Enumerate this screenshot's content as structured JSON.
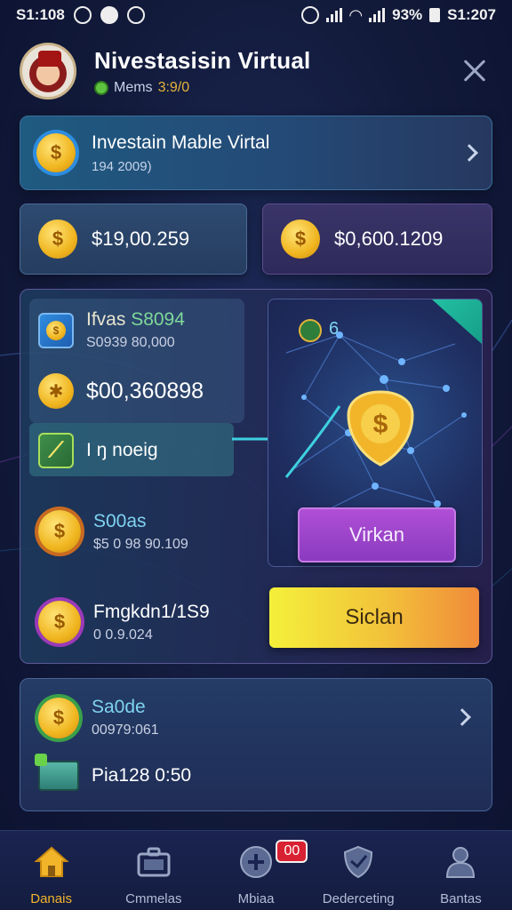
{
  "status_bar": {
    "time": "S1:108",
    "battery": "93%",
    "right_time": "S1:207"
  },
  "header": {
    "title": "Nivestasisin Virtual",
    "status_label": "Mems",
    "status_value": "3:9/0"
  },
  "banner": {
    "title": "Investain Mable Virtal",
    "subtitle": "194 2009)"
  },
  "balances": [
    {
      "value": "$19,00.259"
    },
    {
      "value": "$0,600.1209"
    }
  ],
  "panel": {
    "item1_title_main": "Ifvas ",
    "item1_title_accent": "S8094",
    "item1_sub": "S0939 80,000",
    "item2_value": "$00,360898",
    "item3_title": "I ŋ noeig",
    "item4_title": "S00as",
    "item4_sub": "$5 0 98 90.109",
    "item5_title": "Fmgkdn1/1S9",
    "item5_sub": "0 0.9.024",
    "pin_number": "6",
    "button_purple": "Virkan",
    "button_yellow": "Siclan"
  },
  "card2": {
    "title": "Sa0de",
    "subtitle": "00979:061",
    "row2": "Pia128 0:50"
  },
  "nav": {
    "items": [
      {
        "label": "Danais",
        "icon": "home-icon",
        "active": true
      },
      {
        "label": "Cmmelas",
        "icon": "briefcase-icon",
        "active": false
      },
      {
        "label": "Mbiaa",
        "icon": "plus-circle-icon",
        "active": false,
        "badge": "00"
      },
      {
        "label": "Dederceting",
        "icon": "shield-icon",
        "active": false
      },
      {
        "label": "Bantas",
        "icon": "user-icon",
        "active": false
      }
    ]
  },
  "colors": {
    "accent_gold": "#f2b52a",
    "button_purple": "#9a44c8",
    "button_yellow": "#f4e03a",
    "badge_red": "#d82233"
  }
}
